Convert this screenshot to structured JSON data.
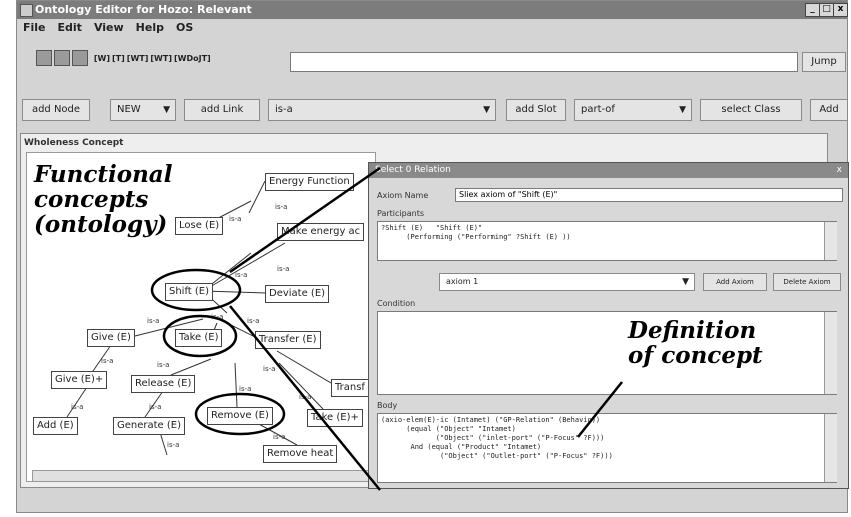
{
  "window": {
    "title": "Ontology Editor for Hozo: Relevant",
    "minimize": "_",
    "maximize": "□",
    "close": "x"
  },
  "menu": [
    "File",
    "Edit",
    "View",
    "Help",
    "OS"
  ],
  "toolbar": {
    "small_buttons": [
      "[W]",
      "[T]",
      "[WT]",
      "[WT]",
      "[WDoJT]"
    ],
    "jump_label": "Jump"
  },
  "actions": {
    "add_node": "add Node",
    "new_combo": "NEW",
    "add_link": "add Link",
    "link_combo": "is-a",
    "add_slot": "add Slot",
    "slot_combo": "part-of",
    "select_class": "select Class",
    "add_more": "Add"
  },
  "panel": {
    "title": "Wholeness Concept"
  },
  "nodes": [
    "Energy Function",
    "Lose (E)",
    "Make energy ac",
    "Shift (E)",
    "Deviate (E)",
    "Give (E)",
    "Take (E)",
    "Transfer (E)",
    "Give (E)+",
    "Release (E)",
    "Transf",
    "Add (E)",
    "Generate (E)",
    "Remove (E)",
    "Take (E)+",
    "Remove heat"
  ],
  "links": [
    "is-a",
    "is-a",
    "is-a",
    "is-a",
    "is-a",
    "is-a",
    "is-a",
    "is-a",
    "is-a",
    "is-a",
    "is-a",
    "is-a",
    "is-a",
    "is-a",
    "is-a",
    "is-a"
  ],
  "dialog": {
    "title": "Select 0 Relation",
    "close": "x",
    "axiom_label": "Axiom Name",
    "axiom_value": "Sliex axiom of \"Shift (E)\"",
    "participants_label": "Participants",
    "participants_text": "?Shift (E)   \"Shift (E)\"\n      (Performing (\"Performing\" ?Shift (E) ))",
    "combo_value": "axiom 1",
    "add_axiom": "Add Axiom",
    "delete_axiom": "Delete Axiom",
    "condition_label": "Condition",
    "condition_text": "",
    "body_label": "Body",
    "body_text": "(axio-elem(E)-ic (Intamet) (\"GP-Relation\" (Behavio))\n      (equal (\"Object\" \"Intamet)\n             (\"Object\" (\"inlet-port\" (\"P-Focus\" ?F)))\n       And (equal (\"Product\" \"Intamet)\n              (\"Object\" (\"Outlet-port\" (\"P-Focus\" ?F)))"
  },
  "annotations": {
    "functional": "Functional\nconcepts\n(ontology)",
    "definition": "Definition\nof concept"
  }
}
